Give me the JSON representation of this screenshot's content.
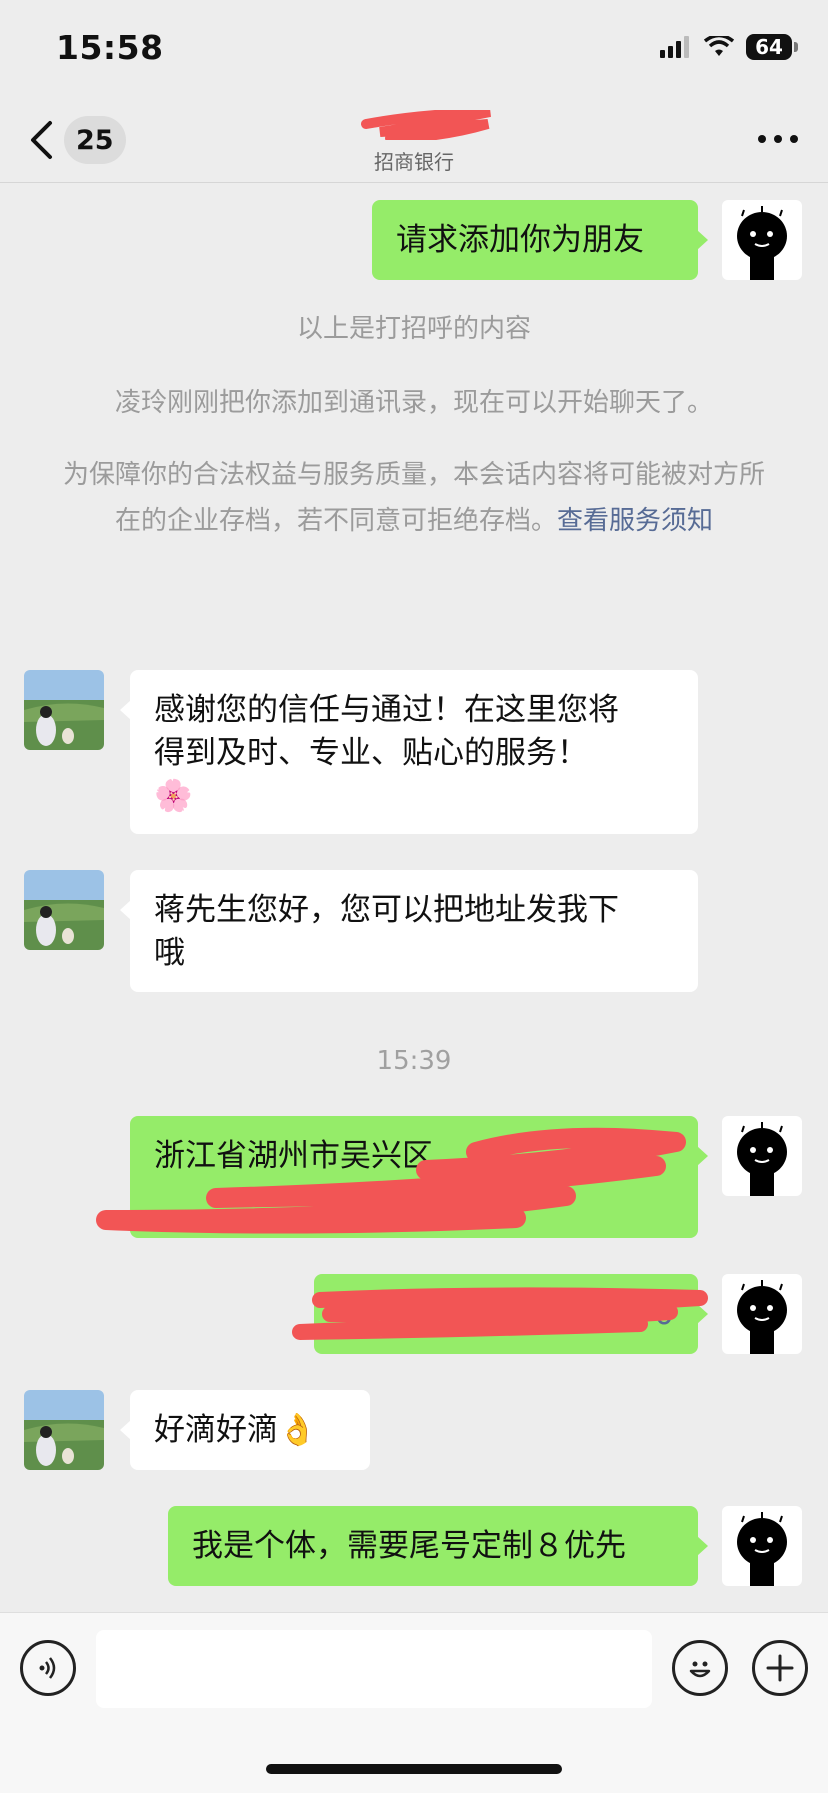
{
  "status_bar": {
    "time": "15:58",
    "battery": "64"
  },
  "header": {
    "unread_count": "25",
    "company": "招商银行"
  },
  "messages": {
    "m1": "请求添加你为朋友",
    "sys1": "以上是打招呼的内容",
    "sys2": "凌玲刚刚把你添加到通讯录，现在可以开始聊天了。",
    "sys3": "为保障你的合法权益与服务质量，本会话内容将可能被对方所在的企业存档，若不同意可拒绝存档。",
    "sys3_link": "查看服务须知",
    "m2_line1": "感谢您的信任与通过！在这里您将",
    "m2_line2": "得到及时、专业、贴心的服务！",
    "m2_emoji": "🌸",
    "m3_line1": "蒋先生您好，您可以把地址发我下",
    "m3_line2": "哦",
    "time_divider": "15:39",
    "m4_visible": "浙江省湖州市吴兴区",
    "m5_visible": "0",
    "m6": "好滴好滴",
    "m6_emoji": "👌",
    "m7": "我是个体，需要尾号定制８优先"
  },
  "colors": {
    "outgoing_bubble": "#95ec69",
    "incoming_bubble": "#ffffff",
    "background": "#ededed",
    "link": "#576b95",
    "redaction": "#f25555"
  },
  "icons": [
    "chevron-left-icon",
    "more-icon",
    "voice-icon",
    "emoji-icon",
    "plus-icon"
  ]
}
